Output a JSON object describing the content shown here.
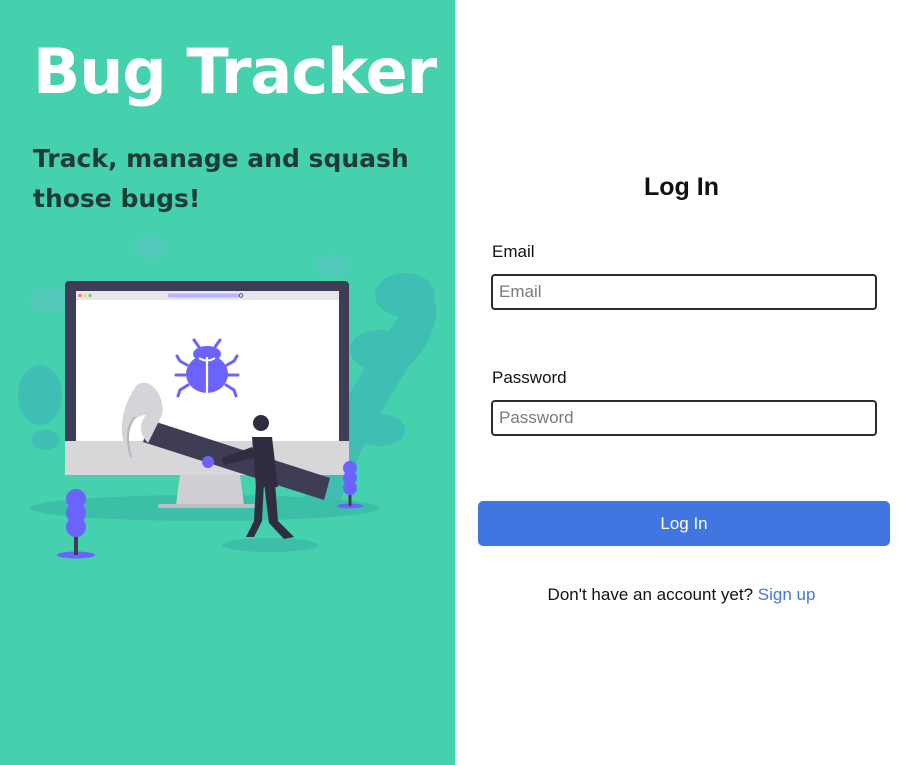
{
  "hero": {
    "title": "Bug Tracker",
    "tagline": "Track, manage and squash those bugs!"
  },
  "login": {
    "title": "Log In",
    "email": {
      "label": "Email",
      "placeholder": "Email",
      "value": ""
    },
    "password": {
      "label": "Password",
      "placeholder": "Password",
      "value": ""
    },
    "submit_label": "Log In",
    "signup_prompt": "Don't have an account yet?",
    "signup_link": "Sign up"
  },
  "colors": {
    "hero_background": "#45d0ae",
    "accent": "#4176e0",
    "bug": "#6c63ff"
  }
}
